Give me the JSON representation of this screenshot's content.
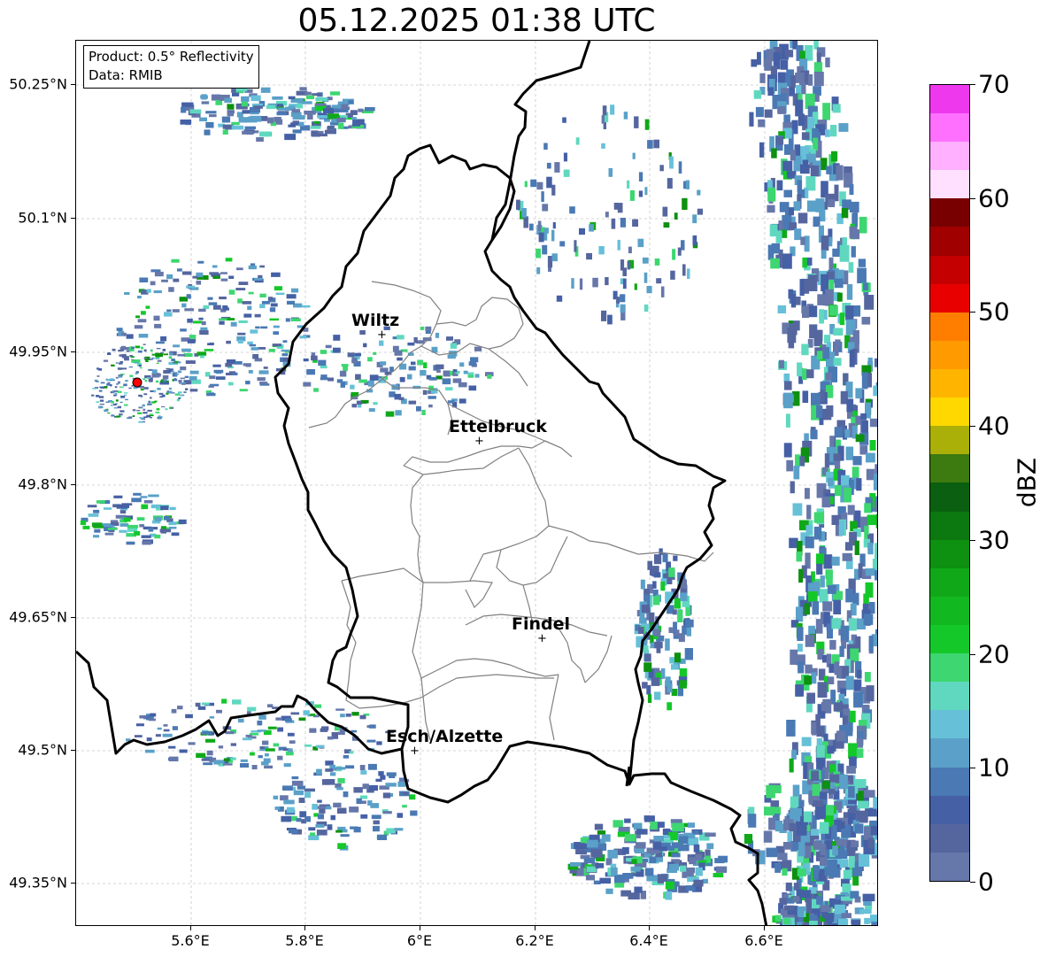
{
  "title": "05.12.2025 01:38 UTC",
  "info": {
    "product": "Product: 0.5° Reflectivity",
    "data": "Data: RMIB"
  },
  "y_axis_labels": [
    "50.25°N",
    "50.1°N",
    "49.95°N",
    "49.8°N",
    "49.65°N",
    "49.5°N",
    "49.35°N"
  ],
  "x_axis_labels": [
    "5.6°E",
    "5.8°E",
    "6°E",
    "6.2°E",
    "6.4°E",
    "6.6°E"
  ],
  "cities": [
    {
      "name": "Wiltz"
    },
    {
      "name": "Ettelbruck"
    },
    {
      "name": "Findel"
    },
    {
      "name": "Esch/Alzette"
    }
  ],
  "colorbar": {
    "label": "dBZ",
    "ticks": [
      "0",
      "10",
      "20",
      "30",
      "40",
      "50",
      "60",
      "70"
    ],
    "colors": [
      "#6677aa",
      "#55669f",
      "#4560a5",
      "#4a79b4",
      "#5aa0c8",
      "#66c0d8",
      "#60d8c0",
      "#3dd670",
      "#14c82a",
      "#12b820",
      "#10a818",
      "#0e9010",
      "#0c7810",
      "#0a6010",
      "#3d7a10",
      "#aab008",
      "#ffd800",
      "#ffb400",
      "#ff9a00",
      "#ff7e00",
      "#e80000",
      "#c40000",
      "#a00000",
      "#780000",
      "#ffe0ff",
      "#ffb0ff",
      "#ff70ff",
      "#ee38ee"
    ]
  },
  "map": {
    "radar_site": "red-circle-marker",
    "border_color": "#000000",
    "canton_color": "#808080",
    "grid_color": "#c8c8c8"
  }
}
